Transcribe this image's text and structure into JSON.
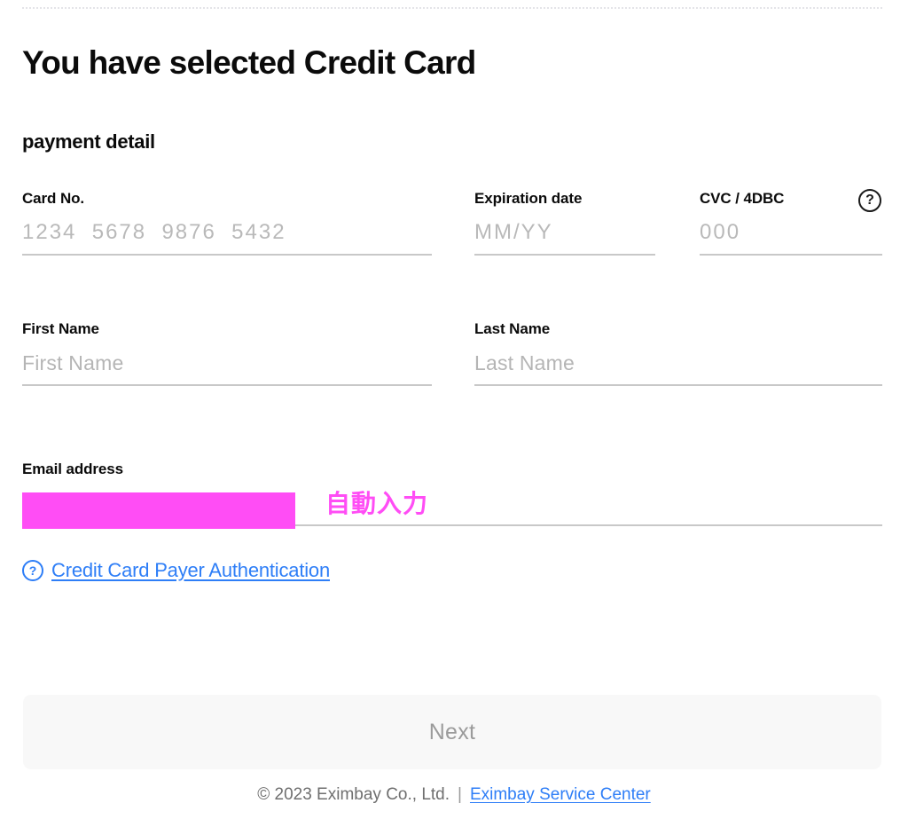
{
  "page": {
    "title": "You have selected Credit Card",
    "section_title": "payment detail"
  },
  "form": {
    "card_no": {
      "label": "Card No.",
      "placeholder": "1234  5678  9876  5432",
      "value": ""
    },
    "expiration_date": {
      "label": "Expiration date",
      "placeholder": "MM/YY",
      "value": ""
    },
    "cvc": {
      "label": "CVC / 4DBC",
      "placeholder": "000",
      "value": "",
      "help_icon": "question-mark-circle-icon",
      "help_glyph": "?"
    },
    "first_name": {
      "label": "First Name",
      "placeholder": "First Name",
      "value": ""
    },
    "last_name": {
      "label": "Last Name",
      "placeholder": "Last Name",
      "value": ""
    },
    "email": {
      "label": "Email address",
      "placeholder": "",
      "value": "",
      "redacted": true
    }
  },
  "annotation": {
    "autofill_note": "自動入力",
    "highlight_color": "#FF4DF5"
  },
  "auth_link": {
    "icon": "question-mark-circle-icon",
    "icon_glyph": "?",
    "label": "Credit Card Payer Authentication",
    "color": "#2E7EF7"
  },
  "actions": {
    "next_label": "Next"
  },
  "footer": {
    "copyright": "© 2023 Eximbay Co., Ltd.",
    "separator": "|",
    "link_label": "Eximbay Service Center",
    "link_color": "#2E7EF7"
  }
}
